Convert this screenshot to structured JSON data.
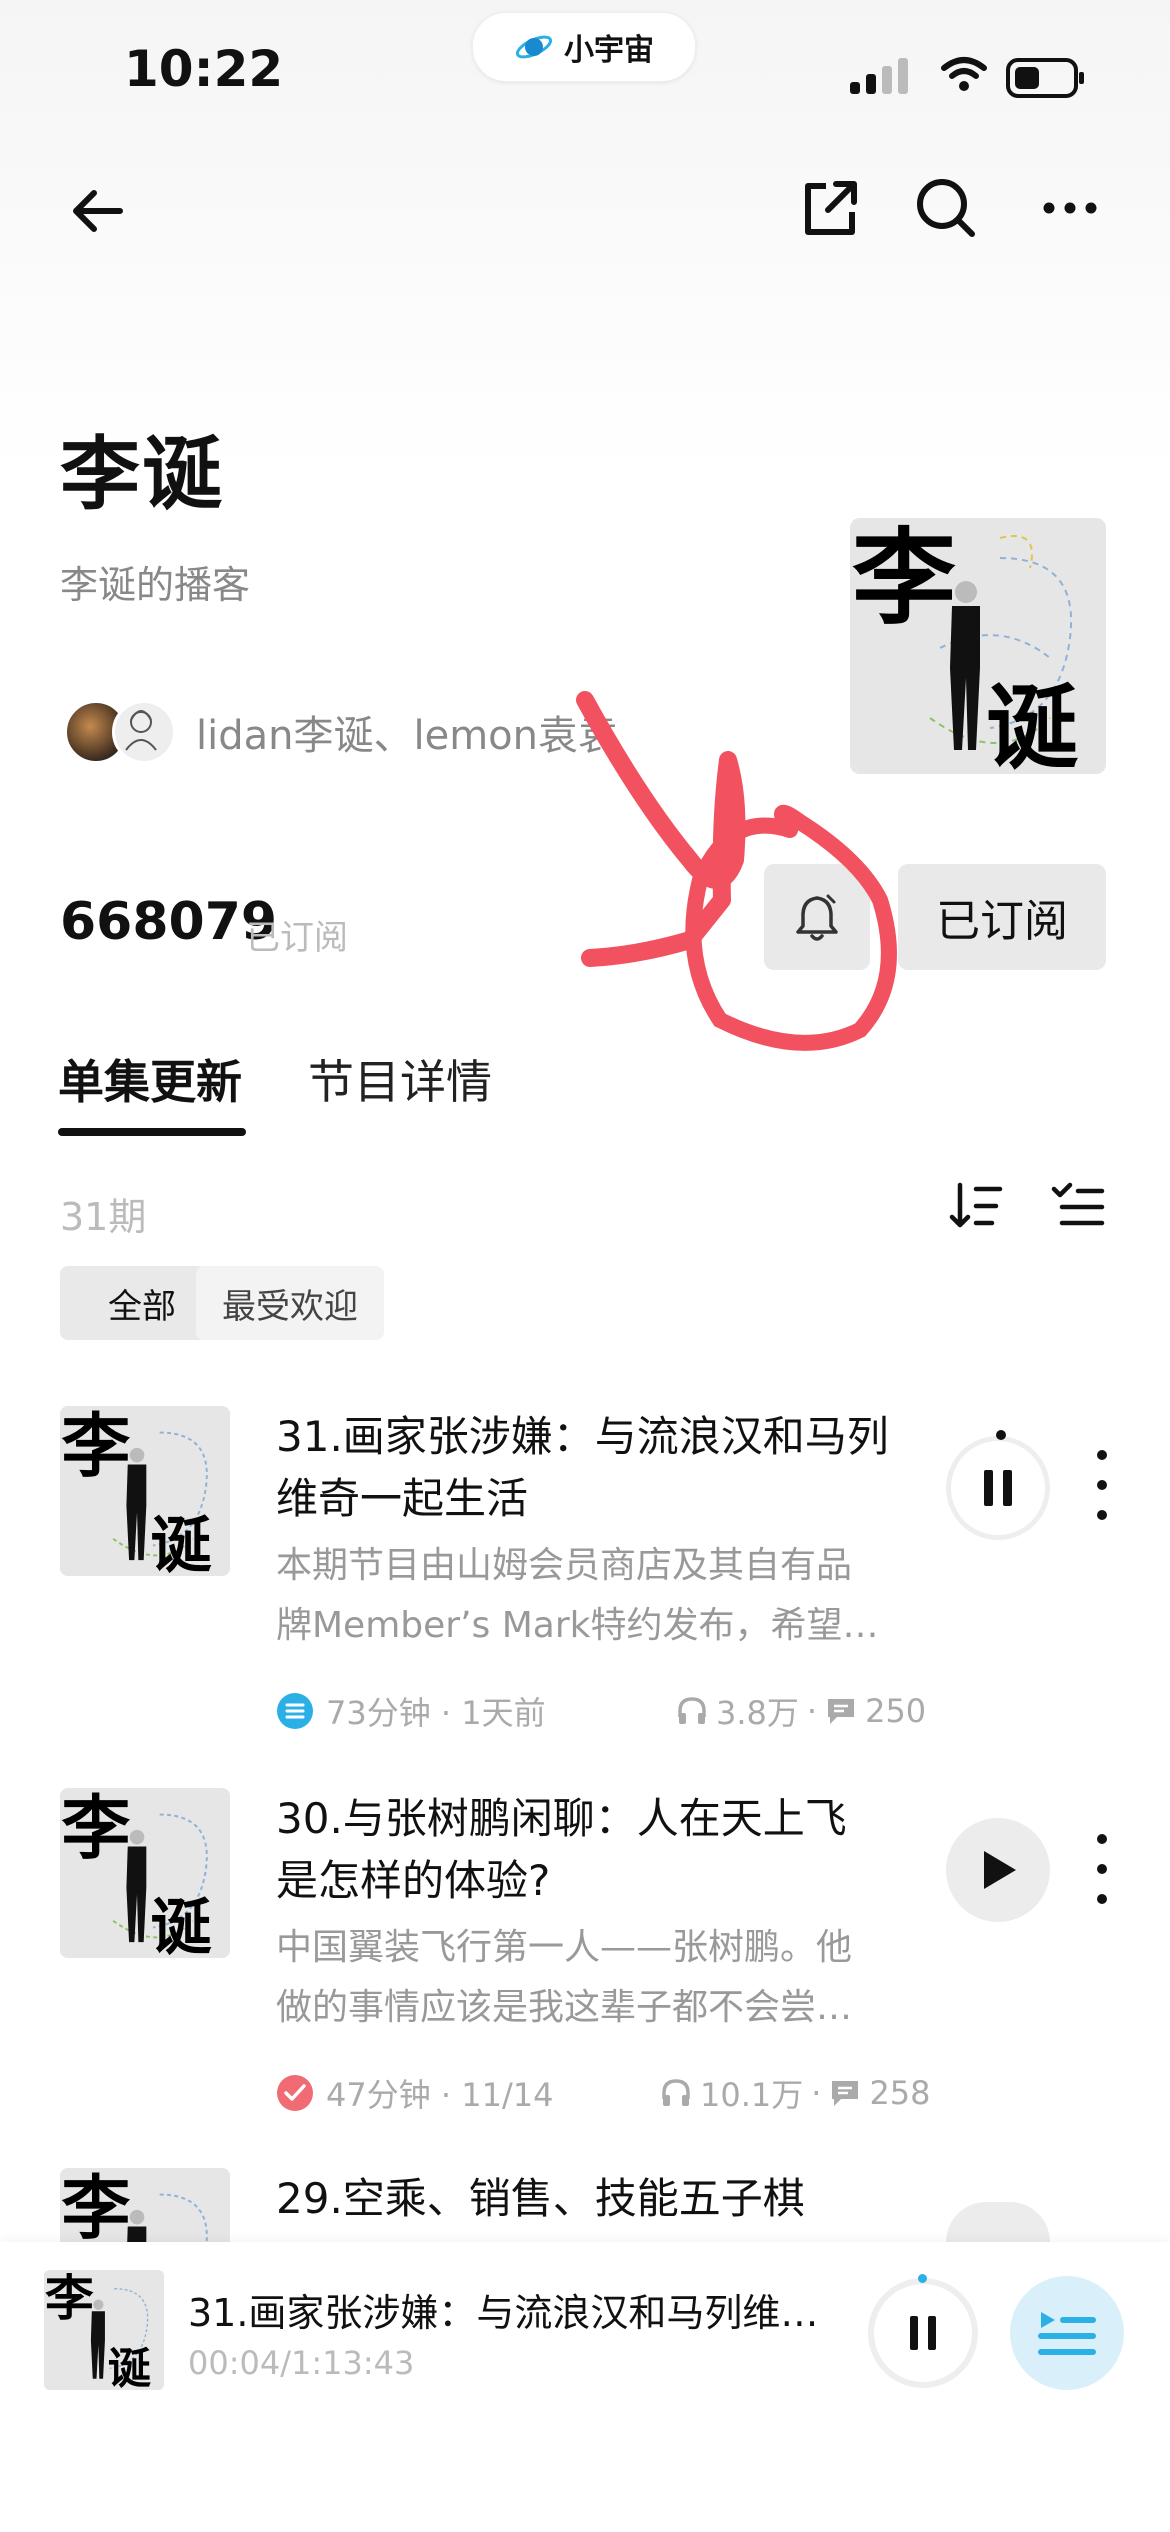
{
  "status_bar": {
    "time": "10:22",
    "app_pill_label": "小宇宙"
  },
  "podcast": {
    "title": "李诞",
    "subtitle": "李诞的播客",
    "hosts": "lidan李诞、lemon袁袁",
    "subscriber_count": "668079",
    "subscriber_label": "已订阅",
    "subscribe_button_label": "已订阅",
    "cover_chars": [
      "李",
      "诞"
    ]
  },
  "tabs": [
    {
      "label": "单集更新",
      "active": true
    },
    {
      "label": "节目详情",
      "active": false
    }
  ],
  "episode_list": {
    "count_label": "31期",
    "filters": [
      "全部",
      "最受欢迎"
    ]
  },
  "episodes": [
    {
      "title": "31.画家张涉嫌：与流浪汉和马列维奇一起生活",
      "title_line1": "31.画家张涉嫌：与流浪汉和马列",
      "title_line2": "维奇一起生活",
      "desc_line1": "本期节目由山姆会员商店及其自有品",
      "desc_line2": "牌Member’s Mark特约发布，希望…",
      "meta": "73分钟 · 1天前",
      "plays": "3.8万",
      "comments": "250",
      "status_icon": "list-icon",
      "state": "playing"
    },
    {
      "title": "30.与张树鹏闲聊：人在天上飞是怎样的体验?",
      "title_line1": "30.与张树鹏闲聊：人在天上飞",
      "title_line2": "是怎样的体验?",
      "desc_line1": "中国翼装飞行第一人——张树鹏。他",
      "desc_line2": "做的事情应该是我这辈子都不会尝…",
      "meta": "47分钟 · 11/14",
      "plays": "10.1万",
      "comments": "258",
      "status_icon": "check-icon",
      "state": "paused"
    },
    {
      "title_line1": "29.空乘、销售、技能五子棋",
      "state": "paused"
    }
  ],
  "player": {
    "title": "31.画家张涉嫌：与流浪汉和马列维…",
    "time": "00:04/1:13:43",
    "progress": 0.0005
  },
  "colors": {
    "accent_blue": "#2bb0e6",
    "annotation_red": "#f2525f",
    "check_red": "#f06b74"
  }
}
